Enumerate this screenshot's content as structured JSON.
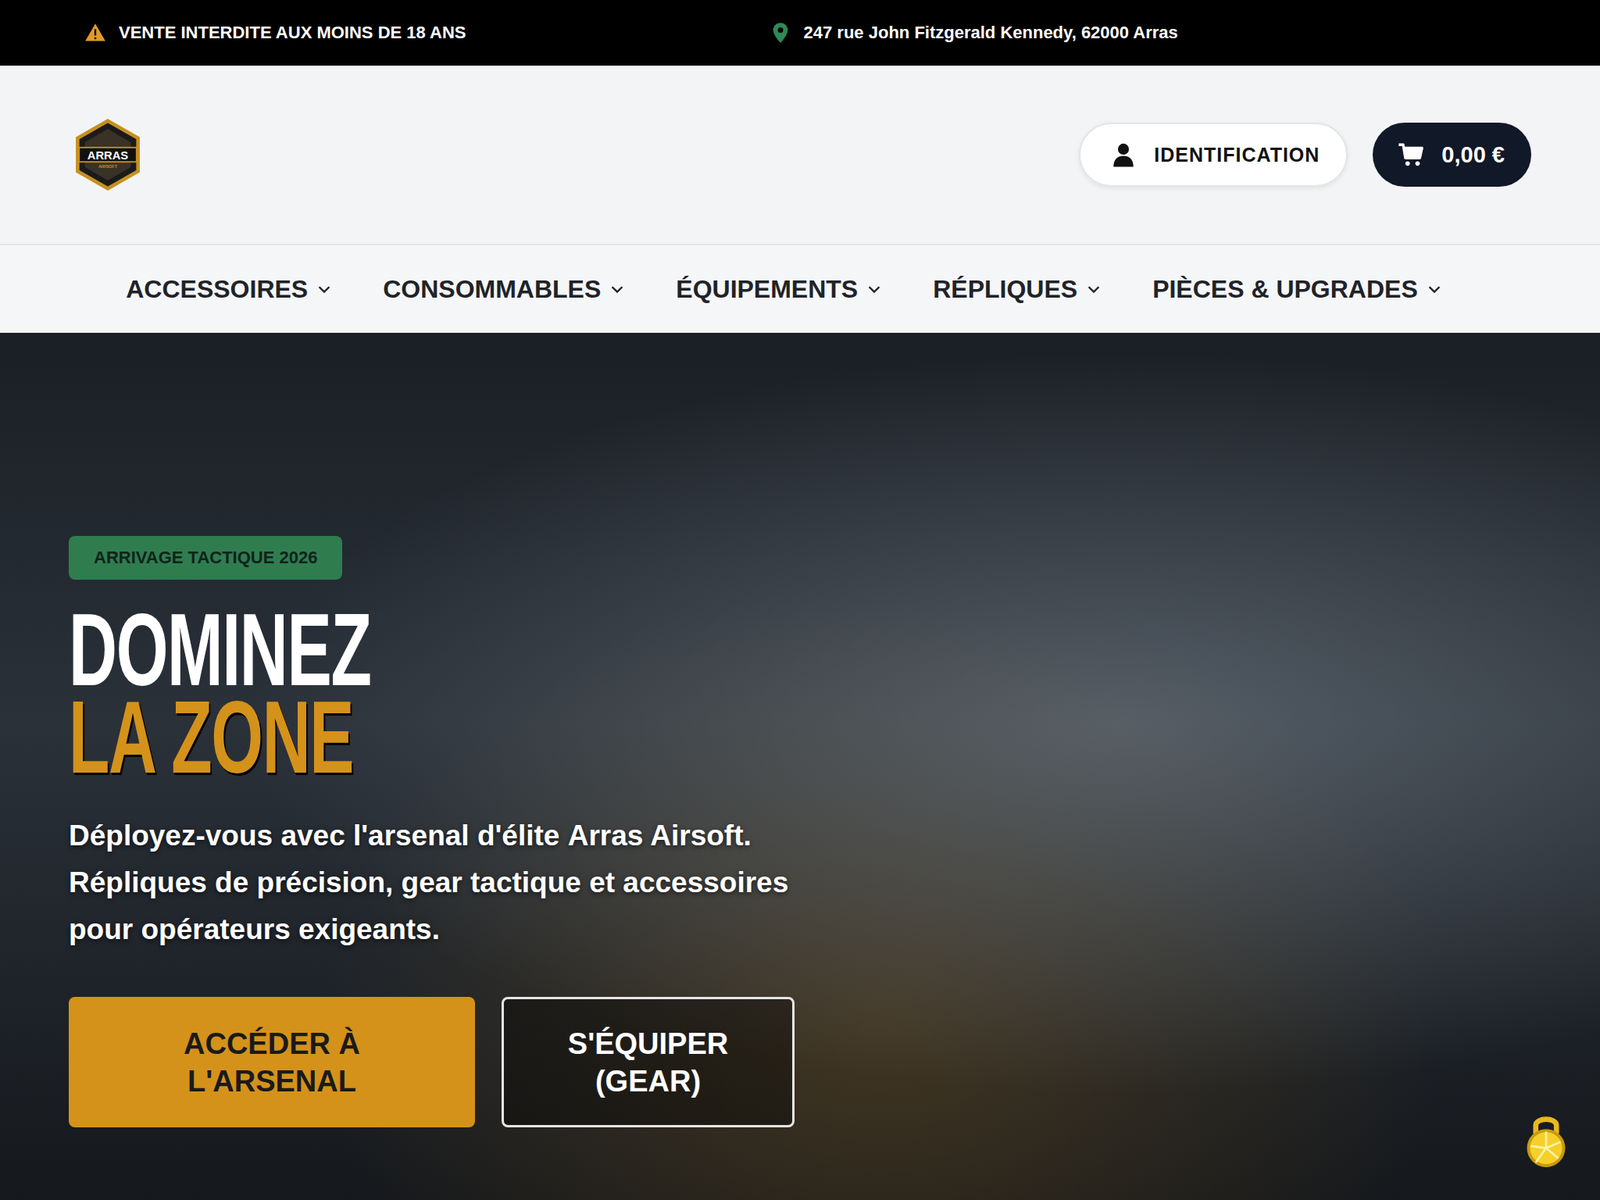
{
  "top_bar": {
    "warning": "VENTE INTERDITE AUX MOINS DE 18 ANS",
    "address": "247 rue John Fitzgerald Kennedy, 62000 Arras"
  },
  "header": {
    "logo": {
      "title": "ARRAS",
      "subtitle": "AIRSOFT"
    },
    "login_button": "IDENTIFICATION",
    "cart_total": "0,00 €"
  },
  "nav": [
    {
      "label": "ACCESSOIRES"
    },
    {
      "label": "CONSOMMABLES"
    },
    {
      "label": "ÉQUIPEMENTS"
    },
    {
      "label": "RÉPLIQUES"
    },
    {
      "label": "PIÈCES & UPGRADES"
    }
  ],
  "hero": {
    "badge": "ARRIVAGE TACTIQUE 2026",
    "title_line1": "DOMINEZ",
    "title_line2": "LA ZONE",
    "text": [
      {
        "text": "Déployez-vous avec l'arsenal d'élite ",
        "bold": false
      },
      {
        "text": "Arras Airsoft",
        "bold": true
      },
      {
        "text": ". Répliques de précision, gear tactique et accessoires pour opérateurs exigeants.",
        "bold": false
      }
    ],
    "buttons": [
      {
        "label": "ACCÉDER À L'ARSENAL",
        "kind": "primary"
      },
      {
        "label": "S'ÉQUIPER (GEAR)",
        "kind": "outline"
      }
    ]
  }
}
